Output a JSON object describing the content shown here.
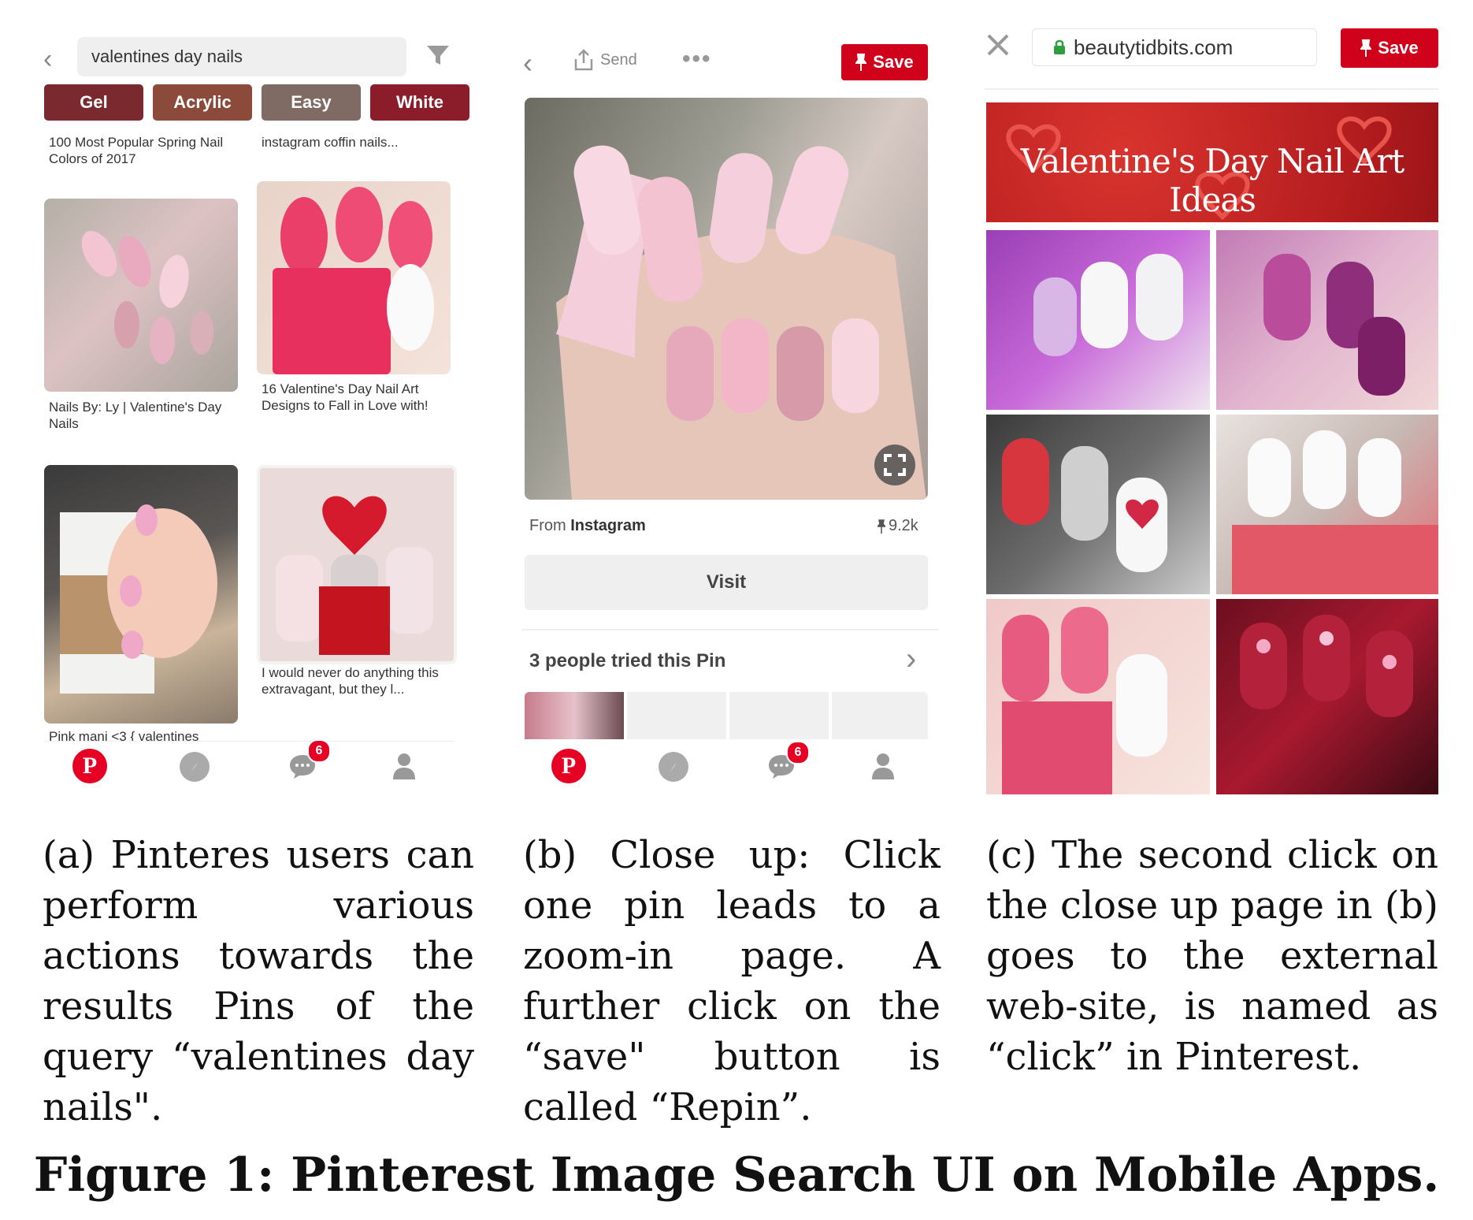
{
  "panel_a": {
    "search_query": "valentines day nails",
    "chips": [
      "Gel",
      "Acrylic",
      "Easy",
      "White"
    ],
    "chip_colors": [
      "#7a2a2e",
      "#8c4a3a",
      "#7f6b64",
      "#8b1d2b"
    ],
    "pins": [
      "100 Most Popular Spring Nail Colors of 2017",
      "instagram coffin nails...",
      "Nails By: Ly | Valentine's Day Nails",
      "16 Valentine's Day Nail Art Designs to Fall in Love with!",
      "Pink mani <3 { valentines",
      "I would never do anything this extravagant, but they l..."
    ],
    "notification_count": "6"
  },
  "panel_b": {
    "send_label": "Send",
    "save_label": "Save",
    "source_prefix": "From",
    "source_name": "Instagram",
    "repin_count": "9.2k",
    "visit_label": "Visit",
    "tried_label": "3 people tried this Pin",
    "notification_count": "6"
  },
  "panel_c": {
    "url": "beautytidbits.com",
    "save_label": "Save",
    "banner_title": "Valentine's Day Nail Art Ideas"
  },
  "captions": {
    "a": "(a) Pinteres users can perform various actions towards the results Pins of the query “valentines day nails\".",
    "b": "(b) Close up: Click one pin leads to a zoom-in page. A further click on the “save\" button is called “Repin”.",
    "c": "(c) The second click on the close up page in (b) goes to the external web-site, is named as “click” in Pinterest."
  },
  "figure_caption": "Figure 1: Pinterest Image Search UI on Mobile Apps.",
  "colors": {
    "pinterest_red": "#e60023",
    "save_red": "#d0021b"
  }
}
